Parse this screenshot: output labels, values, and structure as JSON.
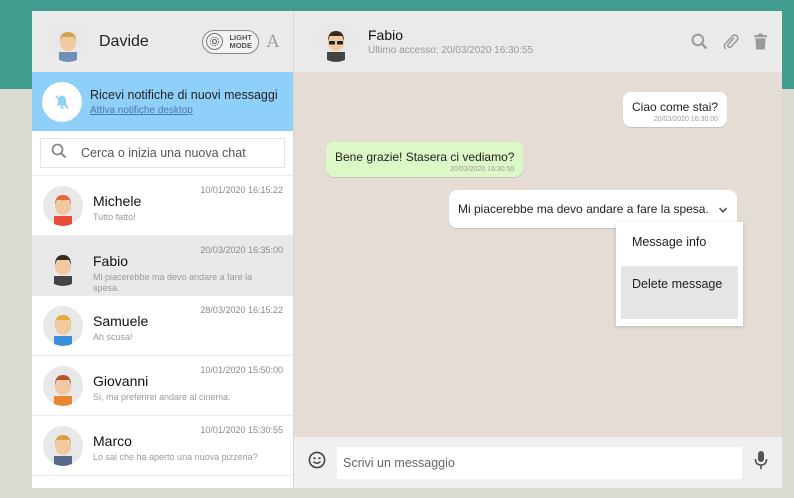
{
  "colors": {
    "accent": "#409c8c",
    "notification": "#8fd0fb",
    "sent_bubble": "#dcf8c6",
    "received_bubble": "#ffffff",
    "chat_bg": "#e5ddd5"
  },
  "user": {
    "name": "Davide",
    "avatar_icon": "avatar-icon"
  },
  "mode_toggle": {
    "label": "LIGHT MODE"
  },
  "font_toggle": {
    "label": "A"
  },
  "notification": {
    "title": "Ricevi notifiche di nuovi messaggi",
    "link": "Attiva notifiche desktop",
    "icon": "bell-off-icon"
  },
  "search": {
    "placeholder": "Cerca o inizia una nuova chat"
  },
  "contacts": [
    {
      "name": "Michele",
      "last": "Tutto fatto!",
      "date": "10/01/2020 16:15:22",
      "active": false,
      "hair": "#e8673c",
      "shirt": "#e84c3d"
    },
    {
      "name": "Fabio",
      "last": "Mi piacerebbe ma devo andare a fare la spesa.",
      "date": "20/03/2020 16:35:00",
      "active": true,
      "hair": "#3a2a1e",
      "shirt": "#444"
    },
    {
      "name": "Samuele",
      "last": "Ah scusa!",
      "date": "28/03/2020 16:15:22",
      "active": false,
      "hair": "#e6a93c",
      "shirt": "#3b8fd8"
    },
    {
      "name": "Giovanni",
      "last": "Si, ma preferirei andare al cinema.",
      "date": "10/01/2020 15:50:00",
      "active": false,
      "hair": "#b5562f",
      "shirt": "#e7862f"
    },
    {
      "name": "Marco",
      "last": "Lo sai che ha aperto una nuova pizzeria?",
      "date": "10/01/2020 15:30:55",
      "active": false,
      "hair": "#d8a040",
      "shirt": "#5a6a8a"
    }
  ],
  "chat": {
    "name": "Fabio",
    "status": "Ultimo accesso: 20/03/2020 16:30:55",
    "messages": [
      {
        "text": "Ciao come stai?",
        "time": "20/03/2020 16:30:00",
        "type": "in"
      },
      {
        "text": "Bene grazie! Stasera ci vediamo?",
        "time": "20/03/2020 16:30:55",
        "type": "out"
      },
      {
        "text": "Mi piacerebbe ma devo andare a fare la spesa.",
        "time": "",
        "type": "in"
      }
    ],
    "menu": {
      "info": "Message info",
      "delete": "Delete message"
    }
  },
  "composer": {
    "placeholder": "Scrivi un messaggio"
  }
}
